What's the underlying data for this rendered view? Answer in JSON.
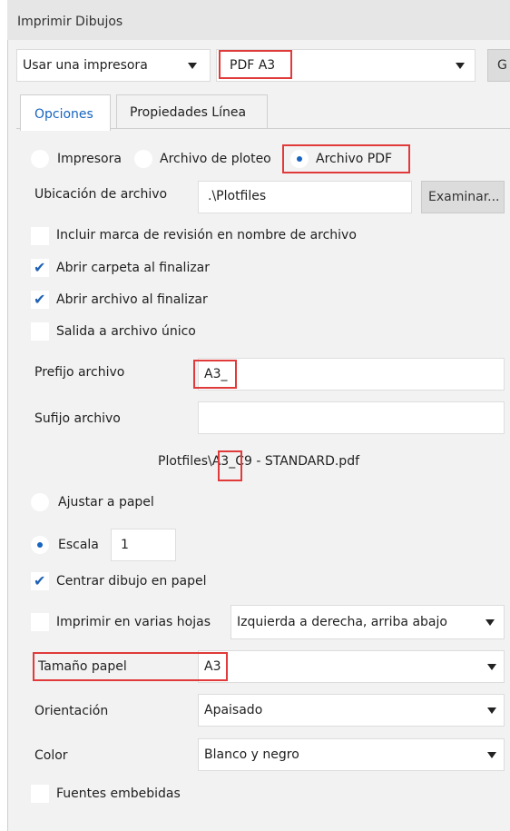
{
  "window": {
    "title": "Imprimir Dibujos"
  },
  "toolbar": {
    "printer_mode": "Usar una impresora",
    "printer_name": "PDF A3",
    "cut_button": "G"
  },
  "tabs": [
    {
      "label": "Opciones",
      "active": true
    },
    {
      "label": "Propiedades Línea",
      "active": false
    }
  ],
  "output": {
    "options": [
      "Impresora",
      "Archivo de ploteo",
      "Archivo PDF"
    ],
    "selected": "Archivo PDF"
  },
  "file_location": {
    "label": "Ubicación de archivo",
    "value": ".\\Plotfiles",
    "browse": "Examinar..."
  },
  "checks": {
    "revision": {
      "label": "Incluir marca de revisión en nombre de archivo",
      "checked": false
    },
    "open_folder": {
      "label": "Abrir carpeta al finalizar",
      "checked": true
    },
    "open_file": {
      "label": "Abrir archivo al finalizar",
      "checked": true
    },
    "single": {
      "label": "Salida a archivo único",
      "checked": false
    }
  },
  "prefix": {
    "label": "Prefijo archivo",
    "value": "A3_"
  },
  "suffix": {
    "label": "Sufijo archivo",
    "value": ""
  },
  "preview": {
    "before": "Plotfiles\\",
    "highlight": "A3_",
    "after": "C9 - STANDARD.pdf"
  },
  "fit": {
    "fit_label": "Ajustar a papel",
    "scale_label": "Escala",
    "scale_value": "1",
    "selected": "Escala"
  },
  "center": {
    "label": "Centrar dibujo en papel",
    "checked": true
  },
  "multi": {
    "label": "Imprimir en varias hojas",
    "checked": false,
    "order": "Izquierda a derecha, arriba abajo"
  },
  "paper": {
    "label": "Tamaño papel",
    "value": "A3"
  },
  "orientation": {
    "label": "Orientación",
    "value": "Apaisado"
  },
  "color": {
    "label": "Color",
    "value": "Blanco y negro"
  },
  "fonts": {
    "label": "Fuentes embebidas",
    "checked": false
  },
  "colors": {
    "accent": "#1664c0",
    "highlight": "#e03a3a",
    "panel": "#f2f2f2"
  }
}
